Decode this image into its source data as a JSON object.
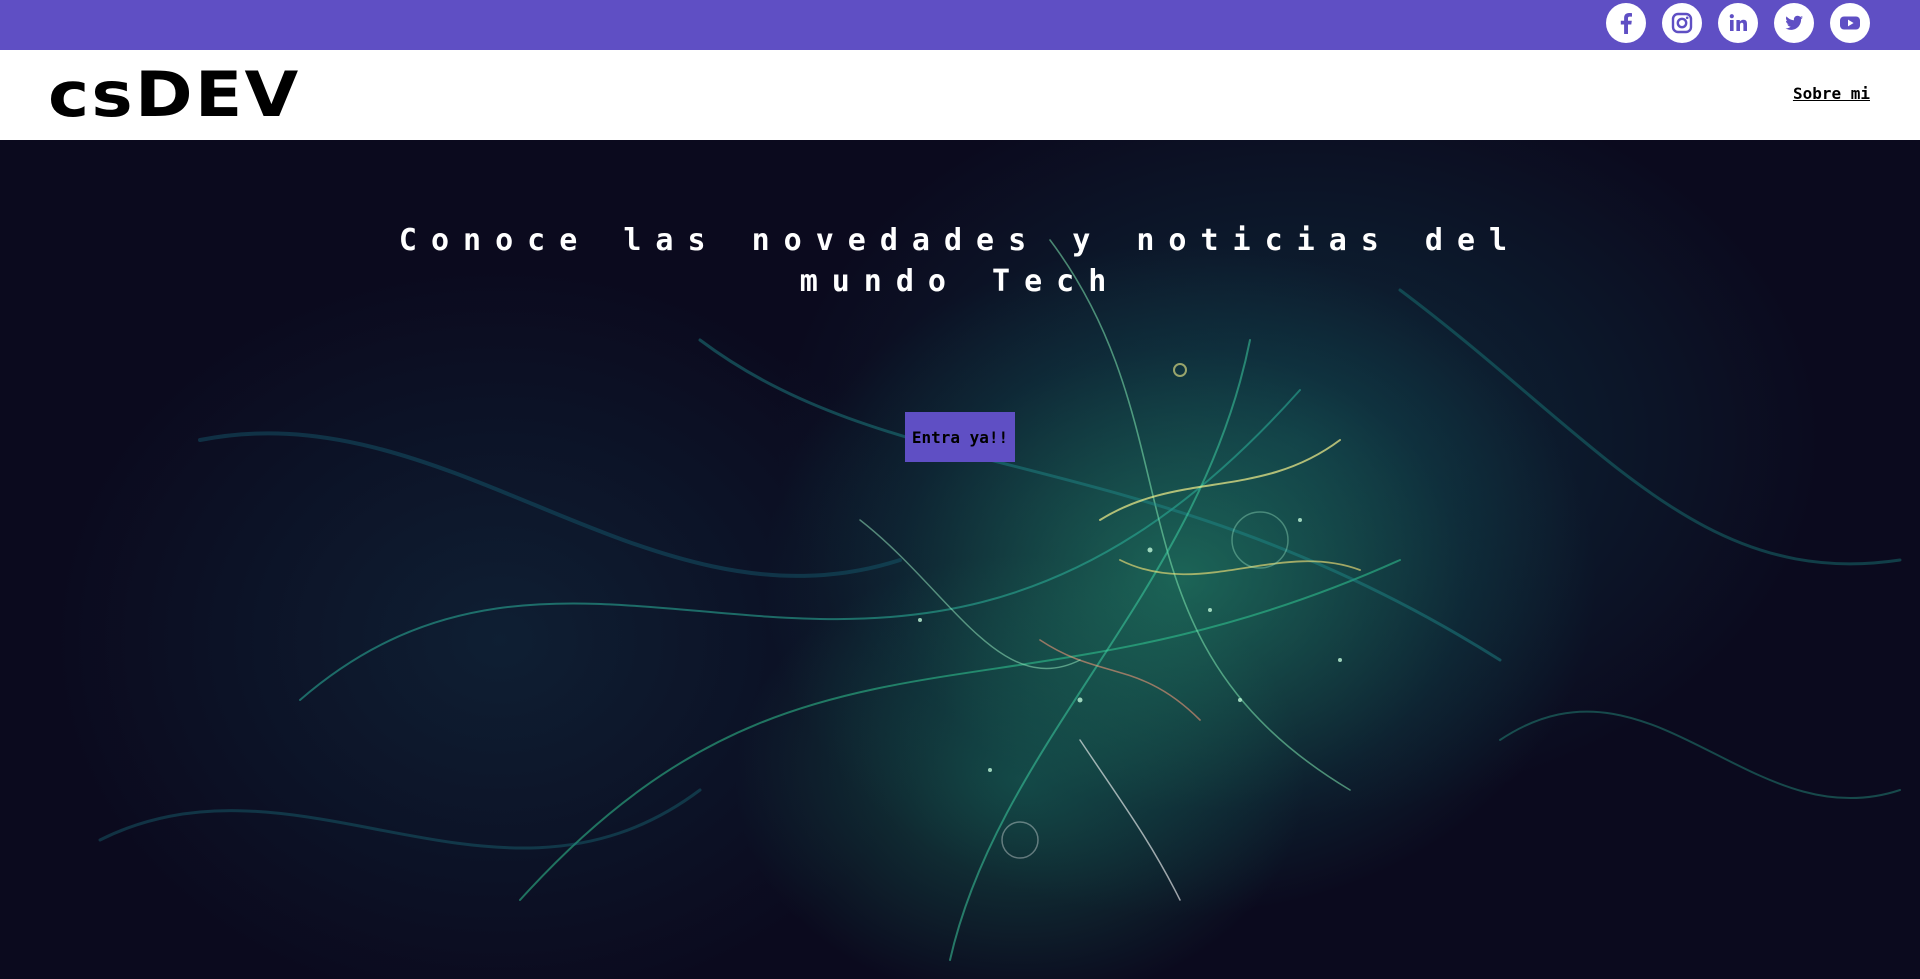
{
  "social": {
    "icons": [
      "facebook-icon",
      "instagram-icon",
      "linkedin-icon",
      "twitter-icon",
      "youtube-icon"
    ]
  },
  "header": {
    "logo": "csDEV",
    "nav_link": "Sobre mi"
  },
  "hero": {
    "title": "Conoce las novedades y noticias del mundo Tech",
    "button_label": "Entra ya!!"
  },
  "colors": {
    "accent": "#5f4fc4",
    "header_bg": "#ffffff",
    "hero_bg": "#0b0a1e"
  }
}
